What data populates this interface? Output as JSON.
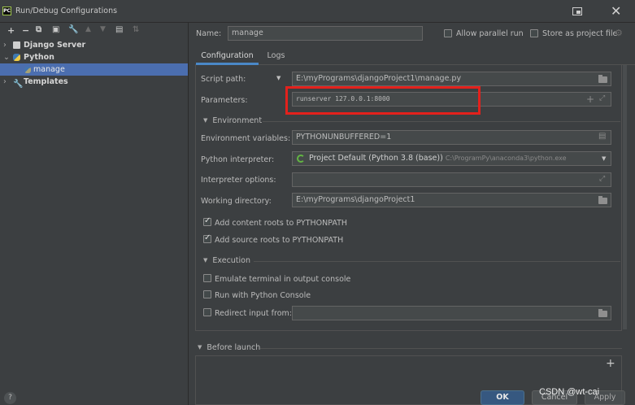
{
  "window": {
    "title": "Run/Debug Configurations",
    "app_icon_text": "PC"
  },
  "toolbar": {
    "icons": [
      "add-icon",
      "remove-icon",
      "copy-icon",
      "save-icon",
      "wrench-icon",
      "move-up-icon",
      "move-down-icon",
      "folder-add-icon",
      "sort-icon"
    ]
  },
  "tree": {
    "items": [
      {
        "label": "Django Server",
        "icon": "django-icon",
        "expanded": false
      },
      {
        "label": "Python",
        "icon": "python-icon",
        "expanded": true
      },
      {
        "label": "manage",
        "icon": "python-file-icon",
        "selected": true
      },
      {
        "label": "Templates",
        "icon": "wrench-icon",
        "expanded": false
      }
    ]
  },
  "header": {
    "name_label": "Name:",
    "name_value": "manage",
    "allow_parallel_label": "Allow parallel run",
    "store_as_project_label": "Store as project file"
  },
  "tabs": [
    {
      "label": "Configuration",
      "active": true
    },
    {
      "label": "Logs",
      "active": false
    }
  ],
  "form": {
    "script_path_label": "Script path:",
    "script_path_value": "E:\\myPrograms\\djangoProject1\\manage.py",
    "parameters_label": "Parameters:",
    "parameters_value": "runserver 127.0.0.1:8000",
    "environment_section": "Environment",
    "env_vars_label": "Environment variables:",
    "env_vars_value": "PYTHONUNBUFFERED=1",
    "interpreter_label": "Python interpreter:",
    "interpreter_value": "Project Default (Python 3.8 (base))",
    "interpreter_path": "C:\\ProgramPy\\anaconda3\\python.exe",
    "interpreter_options_label": "Interpreter options:",
    "interpreter_options_value": "",
    "working_dir_label": "Working directory:",
    "working_dir_value": "E:\\myPrograms\\djangoProject1",
    "add_content_roots_label": "Add content roots to PYTHONPATH",
    "add_content_roots_checked": true,
    "add_source_roots_label": "Add source roots to PYTHONPATH",
    "add_source_roots_checked": true,
    "execution_section": "Execution",
    "emulate_terminal_label": "Emulate terminal in output console",
    "emulate_terminal_checked": false,
    "run_python_console_label": "Run with Python Console",
    "run_python_console_checked": false,
    "redirect_input_label": "Redirect input from:",
    "redirect_input_checked": false,
    "redirect_input_value": ""
  },
  "before_launch": {
    "label": "Before launch",
    "add_symbol": "+"
  },
  "buttons": {
    "ok": "OK",
    "cancel": "Cancel",
    "apply": "Apply",
    "help": "?"
  },
  "watermark": "CSDN @wt-cai",
  "colors": {
    "accent": "#4a88c7",
    "highlight": "#e3211c",
    "selection": "#4b6eaf",
    "background": "#3c3f41"
  }
}
